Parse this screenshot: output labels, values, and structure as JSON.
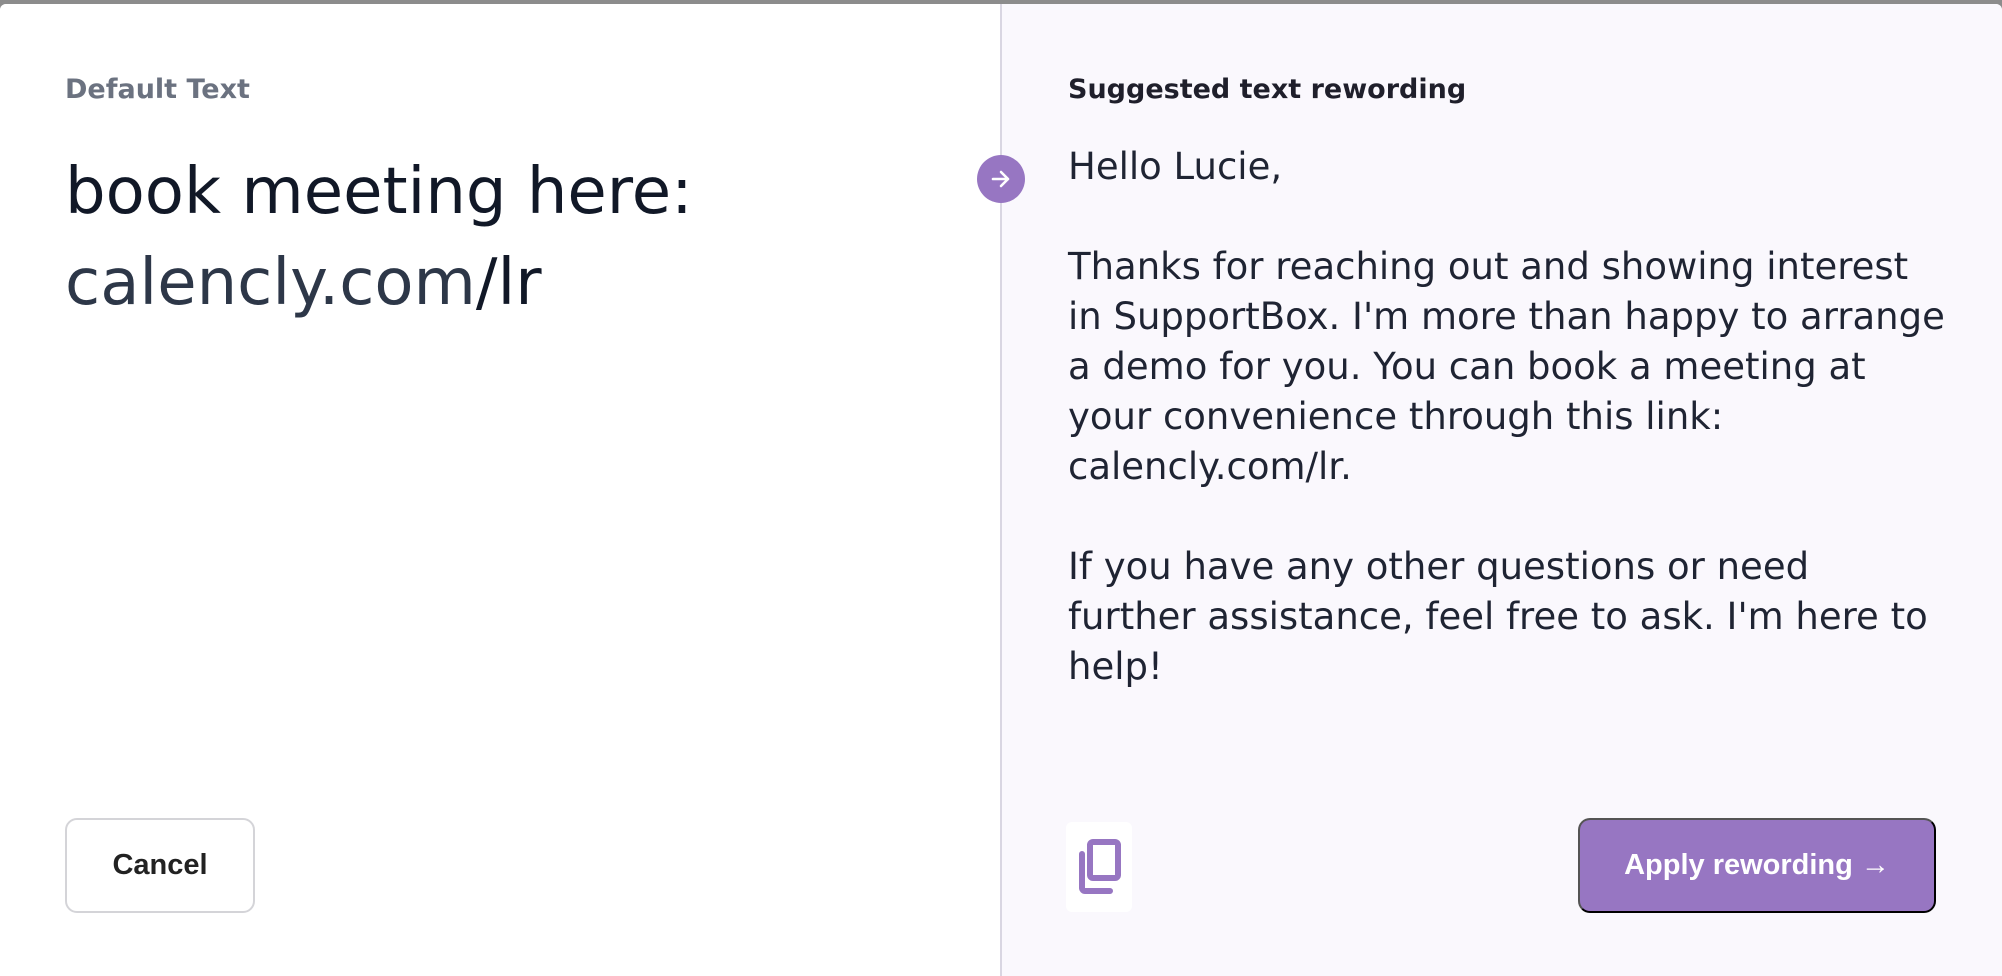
{
  "left_panel": {
    "heading": "Default Text",
    "text_line1": "book meeting here:",
    "text_link": "calencly.com",
    "text_suffix": "/lr",
    "cancel_label": "Cancel"
  },
  "right_panel": {
    "heading": "Suggested text rewording",
    "suggested_text": "Hello Lucie,\n\nThanks for reaching out and showing interest in SupportBox. I'm more than happy to arrange a demo for you. You can book a meeting at your convenience through this link: calencly.com/lr.\n\nIf you have any other questions or need further assistance, feel free to ask. I'm here to help!",
    "apply_label": "Apply rewording →"
  },
  "icons": {
    "arrow": "arrow-right-icon",
    "copy": "copy-icon"
  },
  "colors": {
    "accent": "#9776c2",
    "right_background": "#faf8fd"
  }
}
